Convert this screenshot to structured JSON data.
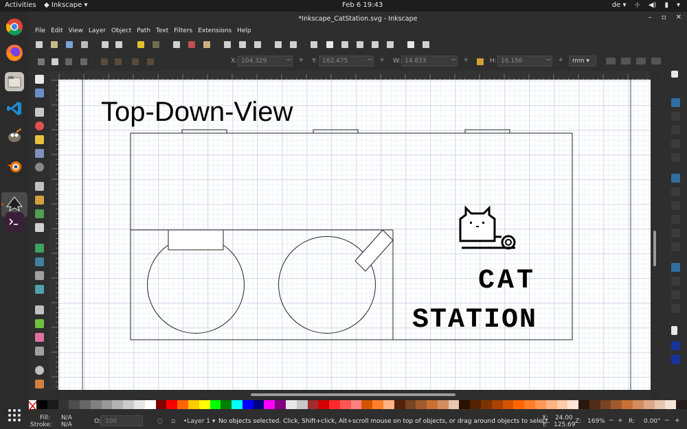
{
  "topbar": {
    "activities": "Activities",
    "app_name": "Inkscape",
    "clock": "Feb 6  19:43",
    "keyboard_layout": "de"
  },
  "window": {
    "title": "*Inkscape_CatStation.svg - Inkscape"
  },
  "menu": [
    "File",
    "Edit",
    "View",
    "Layer",
    "Object",
    "Path",
    "Text",
    "Filters",
    "Extensions",
    "Help"
  ],
  "controls": {
    "x_label": "X:",
    "x_value": "104.329",
    "y_label": "Y:",
    "y_value": "182.475",
    "w_label": "W:",
    "w_value": "14.833",
    "h_label": "H:",
    "h_value": "16.156",
    "unit": "mm"
  },
  "canvas": {
    "heading": "Top-Down-View",
    "logo_line1": "CAT",
    "logo_line2": "STATION"
  },
  "palette": {
    "colors": [
      "#000000",
      "#1a1a1a",
      "#333333",
      "#4d4d4d",
      "#666666",
      "#808080",
      "#999999",
      "#b3b3b3",
      "#cccccc",
      "#e6e6e6",
      "#ffffff",
      "#800000",
      "#ff0000",
      "#ff6600",
      "#ffcc00",
      "#ffff00",
      "#00ff00",
      "#008000",
      "#00ffff",
      "#0000ff",
      "#000080",
      "#ff00ff",
      "#800080",
      "#e6e6e6",
      "#c8c8c8",
      "#a02c2c",
      "#d40000",
      "#ff2a2a",
      "#ff5555",
      "#ff8080",
      "#d45500",
      "#ff7f2a",
      "#ffb380",
      "#55220b",
      "#784421",
      "#a05a2c",
      "#c87137",
      "#d38d5f",
      "#e9c6af",
      "#2b1100",
      "#552200",
      "#803300",
      "#aa4400",
      "#d45500",
      "#ff6600",
      "#ff7f2a",
      "#ff9955",
      "#ffb380",
      "#ffccaa",
      "#ffe6d5",
      "#28170b",
      "#502d16",
      "#784421",
      "#a05a2c",
      "#c87137",
      "#d38d5f",
      "#deaa87",
      "#e9c6af",
      "#f4e3d7",
      "#241c1c"
    ]
  },
  "status": {
    "fill_label": "Fill:",
    "fill_value": "N/A",
    "stroke_label": "Stroke:",
    "stroke_value": "N/A",
    "opacity_label": "O:",
    "opacity_value": "100",
    "layer": "•Layer 1",
    "message": "No objects selected. Click, Shift+click, Alt+scroll mouse on top of objects, or drag around objects to select.",
    "cursor_x_label": "X:",
    "cursor_x": "24.00",
    "cursor_y_label": "Y:",
    "cursor_y": "125.69",
    "zoom_label": "Z:",
    "zoom": "169%",
    "rotation_label": "R:",
    "rotation": "0.00°"
  }
}
